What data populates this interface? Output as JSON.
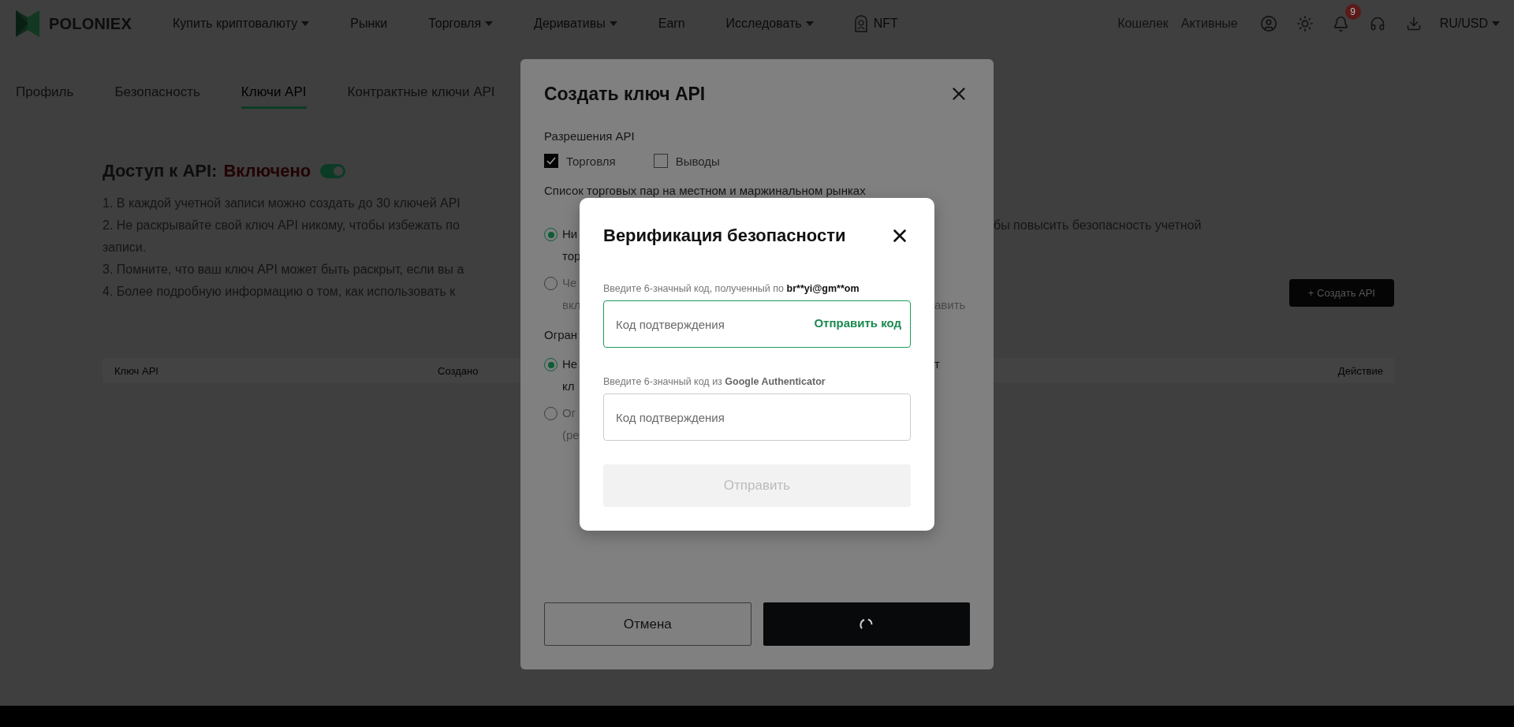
{
  "nav": {
    "logo": "POLONIEX",
    "items": [
      {
        "label": "Купить криптовалюту",
        "dropdown": true,
        "kind": "link"
      },
      {
        "label": "Рынки",
        "dropdown": false,
        "kind": "link"
      },
      {
        "label": "Торговля",
        "dropdown": true,
        "kind": "link"
      },
      {
        "label": "Деривативы",
        "dropdown": true,
        "kind": "link"
      },
      {
        "label": "Earn",
        "dropdown": false,
        "kind": "link"
      },
      {
        "label": "Исследовать",
        "dropdown": true,
        "kind": "link"
      },
      {
        "label": "NFT",
        "dropdown": false,
        "kind": "nft"
      }
    ],
    "right_links": [
      "Кошелек",
      "Активные"
    ],
    "notification_badge": "9",
    "currency": "RU/USD"
  },
  "tabs": [
    {
      "label": "Профиль",
      "selected": false
    },
    {
      "label": "Безопасность",
      "selected": false
    },
    {
      "label": "Ключи API",
      "selected": true
    },
    {
      "label": "Контрактные ключи API",
      "selected": false
    }
  ],
  "api_access": {
    "label": "Доступ к API:",
    "status": "Включено",
    "on": true
  },
  "notes": [
    {
      "text": "1. В каждой учетной записи можно создать до 30 ключей API"
    },
    {
      "text": "2. Не раскрывайте свой ключ API никому, чтобы избежать по",
      "continued": "бы повысить безопасность учетной",
      "wrap": "записи."
    },
    {
      "text": "3. Помните, что ваш ключ API может быть раскрыт, если вы а"
    },
    {
      "text": "4. Более подробную информацию о том, как использовать к"
    }
  ],
  "create_button": "+ Создать API",
  "table": {
    "columns": [
      "Ключ API",
      "Создано",
      "Действие"
    ]
  },
  "create_dialog": {
    "title": "Создать ключ API",
    "permissions_label": "Разрешения API",
    "permissions": [
      {
        "label": "Торговля",
        "checked": true
      },
      {
        "label": "Выводы",
        "checked": false
      }
    ],
    "pairs_label": "Список торговых пар на местном и маржинальном рынках",
    "pair_options": [
      {
        "selected": true,
        "lines": [
          {
            "left": "Ни"
          },
          {
            "left": "тор"
          }
        ]
      },
      {
        "selected": false,
        "lines": [
          {
            "left": "Че"
          },
          {
            "left": "вкл",
            "right": "авить"
          }
        ]
      }
    ],
    "ip_label": "Огран",
    "ip_options": [
      {
        "selected": true,
        "lines": [
          {
            "left": "Не",
            "right": "т"
          },
          {
            "left": "кл"
          }
        ]
      },
      {
        "selected": false,
        "lines": [
          {
            "left": "Ог"
          },
          {
            "left": "(ре"
          }
        ]
      }
    ],
    "cancel": "Отмена",
    "confirm_loading": true
  },
  "verify_dialog": {
    "title": "Верификация безопасности",
    "email_hint": {
      "text": "Введите 6-значный код, полученный по",
      "bold": "br**yi@gm**om"
    },
    "email_field": {
      "placeholder": "Код подтверждения",
      "action": "Отправить код",
      "focused": true
    },
    "ga_hint": {
      "text": "Введите 6-значный код из",
      "bold": "Google Authenticator"
    },
    "ga_field": {
      "placeholder": "Код подтверждения",
      "focused": false
    },
    "submit": {
      "label": "Отправить",
      "disabled": true
    }
  }
}
